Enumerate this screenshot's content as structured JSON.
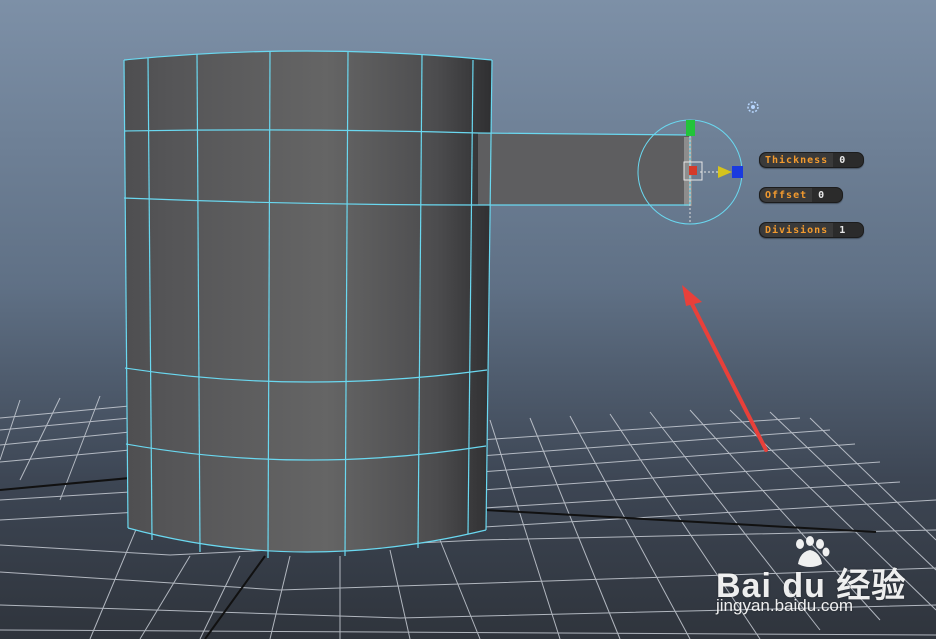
{
  "hud": {
    "thickness": {
      "label": "Thickness",
      "value": "0"
    },
    "offset": {
      "label": "Offset",
      "value": "0"
    },
    "divisions": {
      "label": "Divisions",
      "value": "1"
    }
  },
  "watermark": {
    "brand": "Bai  du 经验",
    "url": "jingyan.baidu.com"
  },
  "colors": {
    "wireframe": "#6ad8f0",
    "mesh": "#5a5a5c",
    "hud_label": "#f29a2e",
    "arrow": "#e8403a",
    "axis_x": "#1a3adf",
    "axis_y": "#22c43a",
    "axis_z": "#d6c31c"
  },
  "icons": [
    "manipulator-icon",
    "view-cube-icon",
    "red-arrow-annotation"
  ]
}
